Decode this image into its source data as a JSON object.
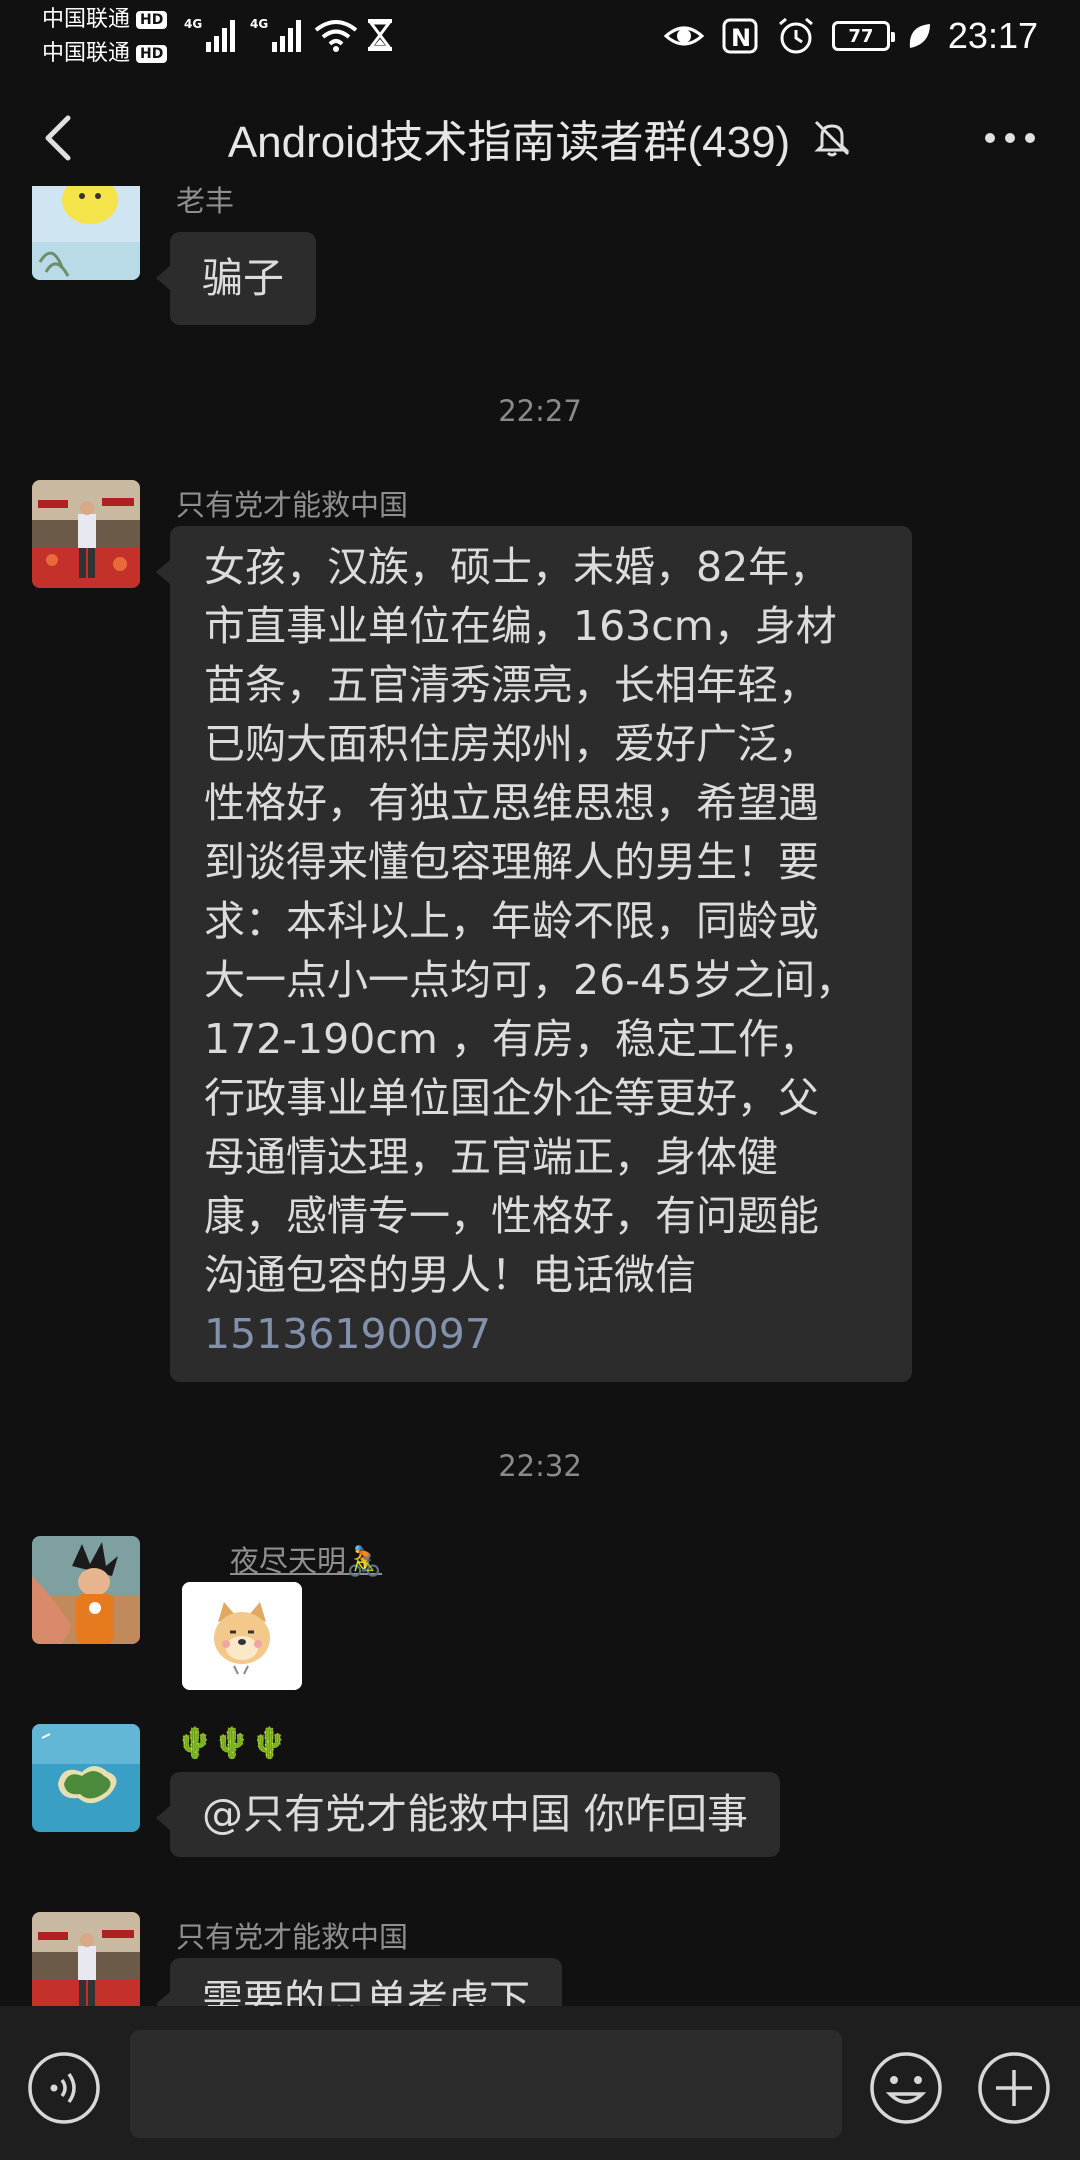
{
  "status_bar": {
    "carrier_1": "中国联通",
    "carrier_2": "中国联通",
    "hd_label": "HD",
    "network_1": "4G",
    "network_2": "4G",
    "battery": "77",
    "time": "23:17"
  },
  "header": {
    "title": "Android技术指南读者群(439)"
  },
  "messages": [
    {
      "type": "text",
      "nickname": "老丰",
      "text": "骗子"
    },
    {
      "type": "time",
      "text": "22:27"
    },
    {
      "type": "text",
      "nickname": "只有党才能救中国",
      "lines": [
        "女孩，汉族，硕士，未婚，82年，",
        "市直事业单位在编，163cm，身材",
        "苗条，五官清秀漂亮，长相年轻，",
        "已购大面积住房郑州，爱好广泛，",
        "性格好，有独立思维思想，希望遇",
        "到谈得来懂包容理解人的男生！要",
        "求：本科以上，年龄不限，同龄或",
        "大一点小一点均可，26-45岁之间，",
        "172-190cm ，有房，稳定工作，",
        "行政事业单位国企外企等更好，父",
        "母通情达理，五官端正，身体健",
        "康，感情专一，性格好，有问题能",
        "沟通包容的男人！电话微信"
      ],
      "phone": "15136190097"
    },
    {
      "type": "time",
      "text": "22:32"
    },
    {
      "type": "sticker",
      "nickname": "夜尽天明🚴"
    },
    {
      "type": "text",
      "nickname": "🌵🌵🌵",
      "text": "@只有党才能救中国  你咋回事"
    },
    {
      "type": "text",
      "nickname": "只有党才能救中国",
      "text": "需要的只单考虑下"
    }
  ],
  "colors": {
    "background": "#111111",
    "bubble": "#2c2c2c",
    "link": "#8391ad",
    "input_bar": "#1e1e1e"
  }
}
